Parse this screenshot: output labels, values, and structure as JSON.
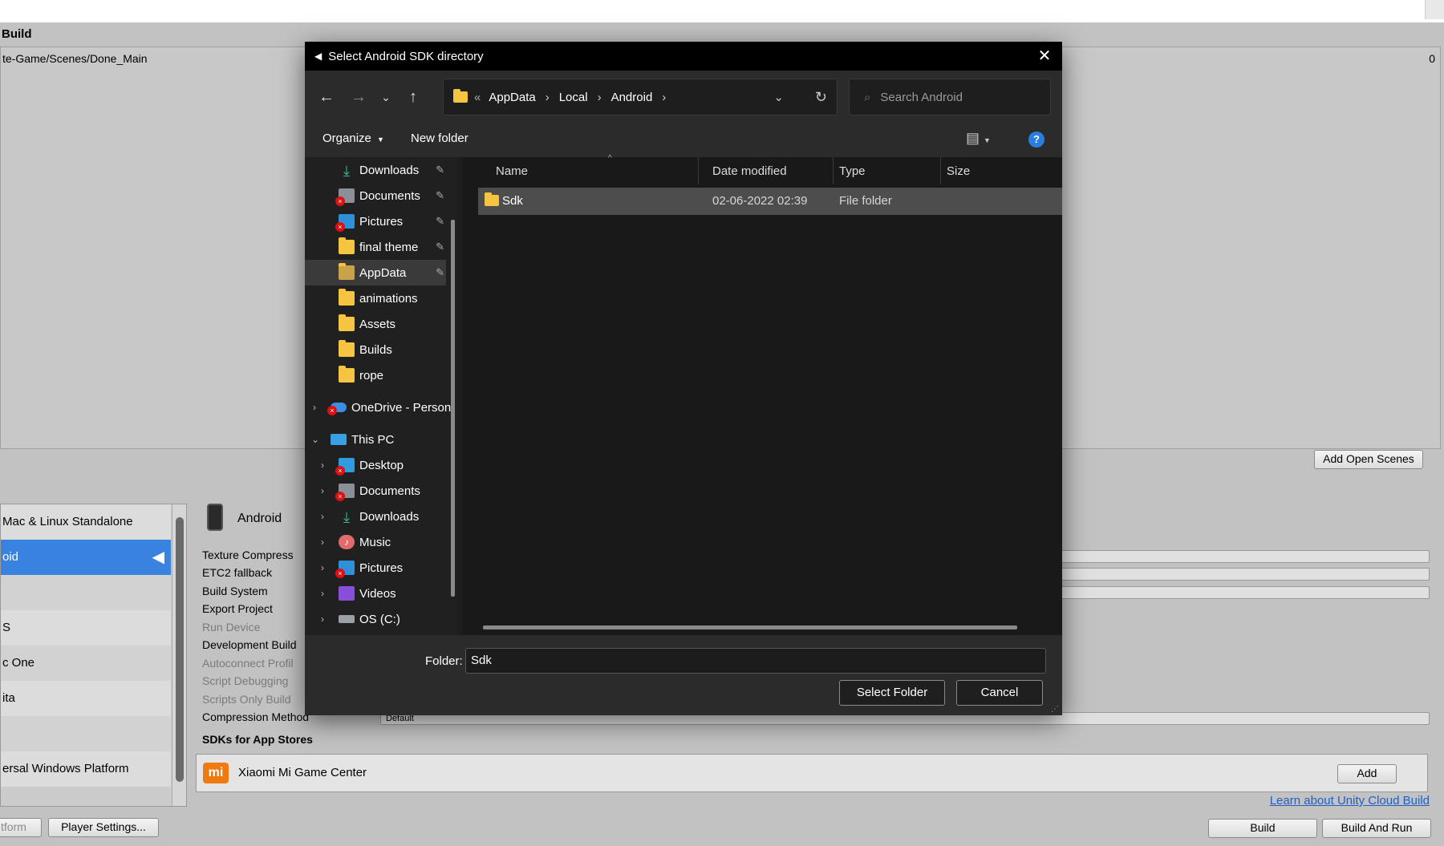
{
  "unity": {
    "build_label": "Build",
    "scene_path": "te-Game/Scenes/Done_Main",
    "scene_index": "0",
    "add_open_scenes": "Add Open Scenes",
    "platforms": [
      "Mac & Linux Standalone",
      "oid",
      "",
      "S",
      "c One",
      "ita",
      "",
      "ersal Windows Platform"
    ],
    "platform_header": "Android",
    "settings": [
      "Texture Compress",
      "ETC2 fallback",
      "Build System",
      "Export Project",
      "Run Device",
      "Development Build",
      "Autoconnect Profil",
      "Script Debugging",
      "Scripts Only Build",
      "Compression Method"
    ],
    "compression_value": "Default",
    "sdks_heading": "SDKs for App Stores",
    "sdk_name": "Xiaomi Mi Game Center",
    "add_label": "Add",
    "cloud_link": "Learn about Unity Cloud Build",
    "switch_platform": "tform",
    "player_settings": "Player Settings...",
    "build": "Build",
    "build_and_run": "Build And Run"
  },
  "dialog": {
    "title": "Select Android SDK directory",
    "breadcrumb": [
      "AppData",
      "Local",
      "Android"
    ],
    "search_placeholder": "Search Android",
    "organize": "Organize",
    "new_folder": "New folder",
    "nav_items": [
      {
        "label": "Downloads",
        "icon": "download-icon",
        "pinned": true
      },
      {
        "label": "Documents",
        "icon": "documents-icon",
        "pinned": true,
        "error": true
      },
      {
        "label": "Pictures",
        "icon": "pictures-icon",
        "pinned": true,
        "error": true
      },
      {
        "label": "final theme",
        "icon": "folder-icon",
        "pinned": true
      },
      {
        "label": "AppData",
        "icon": "folder-icon",
        "pinned": true,
        "selected": true
      },
      {
        "label": "animations",
        "icon": "folder-icon"
      },
      {
        "label": "Assets",
        "icon": "folder-icon"
      },
      {
        "label": "Builds",
        "icon": "folder-icon"
      },
      {
        "label": "rope",
        "icon": "folder-icon"
      }
    ],
    "onedrive": "OneDrive - Person",
    "this_pc": "This PC",
    "pc_items": [
      {
        "label": "Desktop",
        "icon": "desktop-icon",
        "error": true
      },
      {
        "label": "Documents",
        "icon": "documents-icon",
        "error": true
      },
      {
        "label": "Downloads",
        "icon": "download-icon"
      },
      {
        "label": "Music",
        "icon": "music-icon"
      },
      {
        "label": "Pictures",
        "icon": "pictures-icon",
        "error": true
      },
      {
        "label": "Videos",
        "icon": "videos-icon"
      },
      {
        "label": "OS (C:)",
        "icon": "drive-icon"
      }
    ],
    "columns": [
      "Name",
      "Date modified",
      "Type",
      "Size"
    ],
    "files": [
      {
        "name": "Sdk",
        "modified": "02-06-2022 02:39",
        "type": "File folder",
        "size": ""
      }
    ],
    "folder_label": "Folder:",
    "folder_value": "Sdk",
    "select_folder": "Select Folder",
    "cancel": "Cancel"
  }
}
